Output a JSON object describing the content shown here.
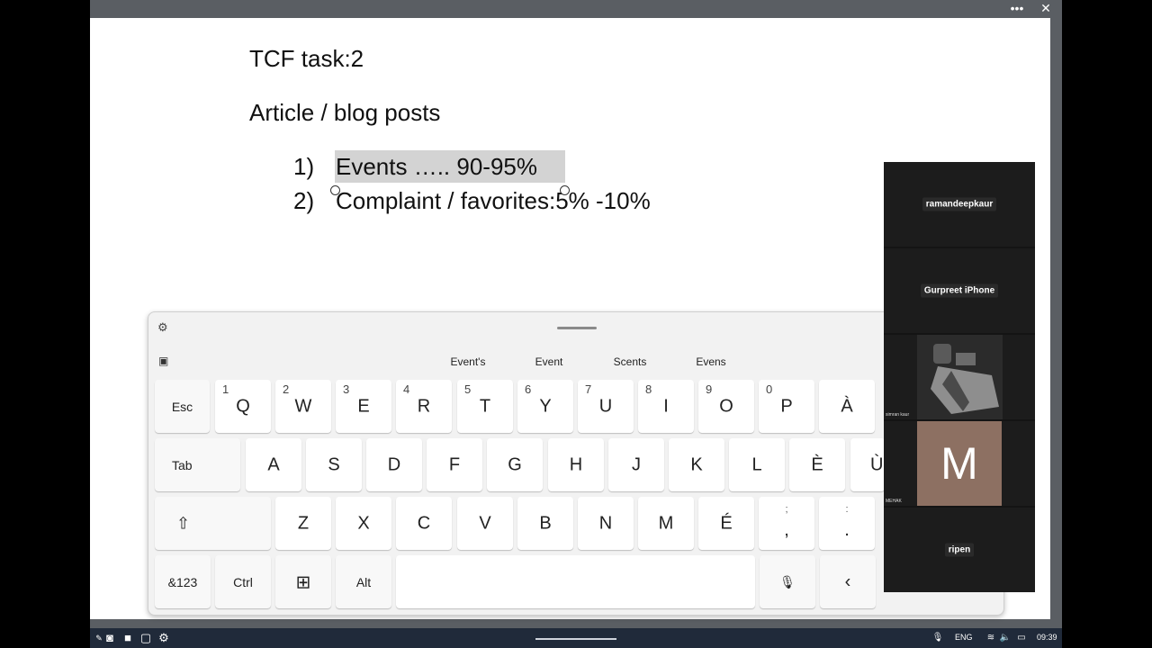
{
  "window": {
    "more_label": "•••",
    "close_label": "✕"
  },
  "document": {
    "title": "TCF task:2",
    "subtitle": "Article / blog posts",
    "items": [
      {
        "num": "1)",
        "text": "Events ….. 90-95%"
      },
      {
        "num": "2)",
        "text": "Complaint / favorites:5% -10%"
      }
    ]
  },
  "keyboard": {
    "suggestions": [
      "Event's",
      "Event",
      "Scents",
      "Evens"
    ],
    "row1": [
      {
        "label": "Esc"
      },
      {
        "label": "Q",
        "num": "1"
      },
      {
        "label": "W",
        "num": "2"
      },
      {
        "label": "E",
        "num": "3"
      },
      {
        "label": "R",
        "num": "4"
      },
      {
        "label": "T",
        "num": "5"
      },
      {
        "label": "Y",
        "num": "6"
      },
      {
        "label": "U",
        "num": "7"
      },
      {
        "label": "I",
        "num": "8"
      },
      {
        "label": "O",
        "num": "9"
      },
      {
        "label": "P",
        "num": "0"
      },
      {
        "label": "À"
      }
    ],
    "row2": [
      "Tab",
      "A",
      "S",
      "D",
      "F",
      "G",
      "H",
      "J",
      "K",
      "L",
      "È",
      "Ù"
    ],
    "row3": [
      {
        "label": "⇧"
      },
      {
        "label": "Z"
      },
      {
        "label": "X"
      },
      {
        "label": "C"
      },
      {
        "label": "V"
      },
      {
        "label": "B"
      },
      {
        "label": "N"
      },
      {
        "label": "M"
      },
      {
        "label": "É"
      },
      {
        "top": ";",
        "label": ","
      },
      {
        "top": ":",
        "label": "."
      }
    ],
    "row4": {
      "sym": "&123",
      "ctrl": "Ctrl",
      "win": "⊞",
      "alt": "Alt",
      "mic": "🎙",
      "left": "‹"
    }
  },
  "participants": [
    {
      "name": "ramandeepkaur"
    },
    {
      "name": "Gurpreet iPhone"
    },
    {
      "name": "",
      "caption": "simran kaur"
    },
    {
      "name": "",
      "initial": "M",
      "caption": "MEHAK",
      "avatar_color": "#8d7062"
    },
    {
      "name": "ripen"
    }
  ],
  "taskbar": {
    "lang": "ENG",
    "time": "09:39"
  }
}
